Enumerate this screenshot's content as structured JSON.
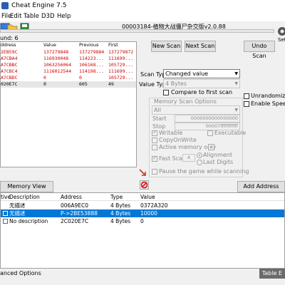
{
  "window": {
    "title": "Cheat Engine 7.5"
  },
  "menu": {
    "file": "File",
    "edit": "Edit",
    "table": "Table",
    "d3d": "D3D",
    "help": "Help"
  },
  "process_title": "00003184-植物大战僵尸杂交版v2.0.88",
  "found_label": "und: 6",
  "results": {
    "headers": [
      "ddress",
      "Value",
      "Previous",
      "First"
    ],
    "rows": [
      [
        "2EB59C",
        "137279848",
        "137279884",
        "137279872"
      ],
      [
        "A7CBA4",
        "116930048",
        "114223...",
        "111699..."
      ],
      [
        "A7CBBC",
        "1063256064",
        "106168...",
        "105729..."
      ],
      [
        "A7CBC4",
        "1116012544",
        "114198...",
        "111699..."
      ],
      [
        "A7CBDC",
        "0",
        "0",
        "105729..."
      ],
      [
        "020E7C",
        "0",
        "605",
        "49"
      ]
    ]
  },
  "buttons": {
    "new_scan": "New Scan",
    "next_scan": "Next Scan",
    "undo_scan": "Undo Scan",
    "memory_view": "Memory View",
    "add_address": "Add Address Manu"
  },
  "settings_label": "Set",
  "scan": {
    "scan_type_label": "Scan Type",
    "scan_type_value": "Changed value",
    "value_type_label": "Value Type",
    "value_type_value": "4 Bytes",
    "compare_first": "Compare to first scan",
    "unrandomizer": "Unrandomizer",
    "enable_speedhack": "Enable Speedh",
    "mem_options_title": "Memory Scan Options",
    "mem_region": "All",
    "start_label": "Start",
    "start_value": "0000000000000000",
    "stop_label": "Stop",
    "stop_value": "00007fffffffffff",
    "writable": "Writable",
    "executable": "Executable",
    "copy_on_write": "CopyOnWrite",
    "active_memory_only": "Active memory only",
    "fast_scan": "Fast Scan",
    "fast_scan_value": "4",
    "alignment": "Alignment",
    "last_digits": "Last Digits",
    "pause_game": "Pause the game while scanning"
  },
  "address_table": {
    "headers": [
      "tive",
      "Description",
      "Address",
      "Type",
      "Value"
    ],
    "rows": [
      {
        "description": "无描述",
        "address": "006A9EC0",
        "type": "4 Bytes",
        "value": "0372A320",
        "selected": false
      },
      {
        "description": "无描述",
        "address": "P->2BE53888",
        "type": "4 Bytes",
        "value": "10000",
        "selected": true
      },
      {
        "description": "No description",
        "address": "2C020E7C",
        "type": "4 Bytes",
        "value": "0",
        "selected": false
      }
    ]
  },
  "status": {
    "left": "anced Options",
    "right": "Table E"
  }
}
